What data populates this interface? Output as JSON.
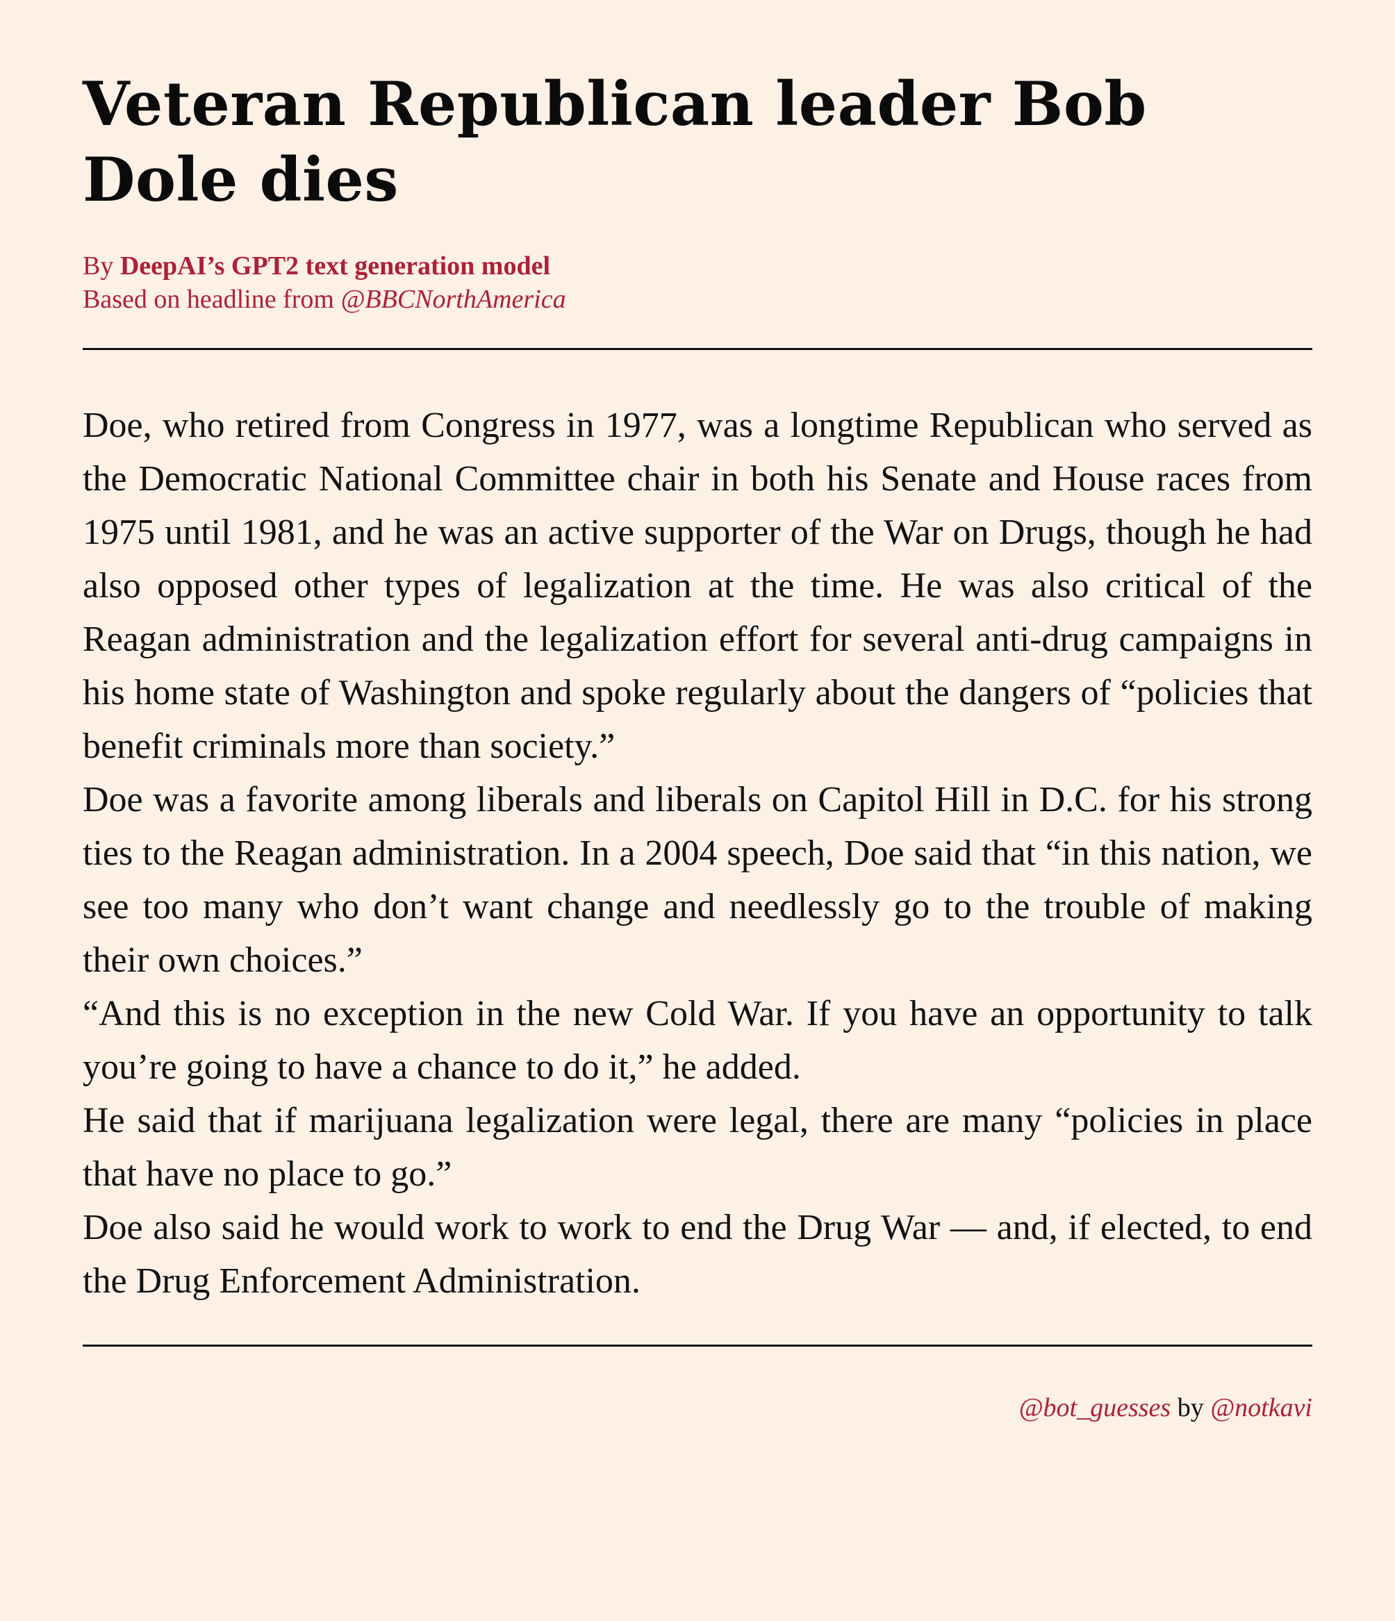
{
  "headline": "Veteran Republican leader Bob Dole dies",
  "byline": {
    "by_prefix": "By ",
    "author": "DeepAI’s GPT2 text generation model",
    "based_on_prefix": "Based on headline from ",
    "source_handle": "@BBCNorthAmerica"
  },
  "paragraphs": [
    "Doe, who retired from Congress in 1977, was a longtime Republican who served as the Democratic National Committee chair in both his Senate and House races from 1975 until 1981, and he was an active supporter of the War on Drugs, though he had also opposed other types of legalization at the time. He was also critical of the Reagan administration and the legalization effort for several anti-drug campaigns in his home state of Washington and spoke regularly about the dangers of “policies that benefit criminals more than society.”",
    "Doe was a favorite among liberals and liberals on Capitol Hill in D.C. for his strong ties to the Reagan administration. In a 2004 speech, Doe said that “in this nation, we see too many who don’t want change and needlessly go to the trouble of making their own choices.”",
    "“And this is no exception in the new Cold War. If you have an opportunity to talk you’re going to have a chance to do it,” he added.",
    "He said that if marijuana legalization were legal, there are many “policies in place that have no place to go.”",
    "Doe also said he would work to work to end the Drug War — and, if elected, to end the Drug Enforcement Administration."
  ],
  "credits": {
    "bot_handle": "@bot_guesses",
    "by_word": " by ",
    "creator_handle": "@notkavi"
  },
  "colors": {
    "background": "#fdf1e6",
    "accent": "#ac2138",
    "text": "#111111"
  }
}
